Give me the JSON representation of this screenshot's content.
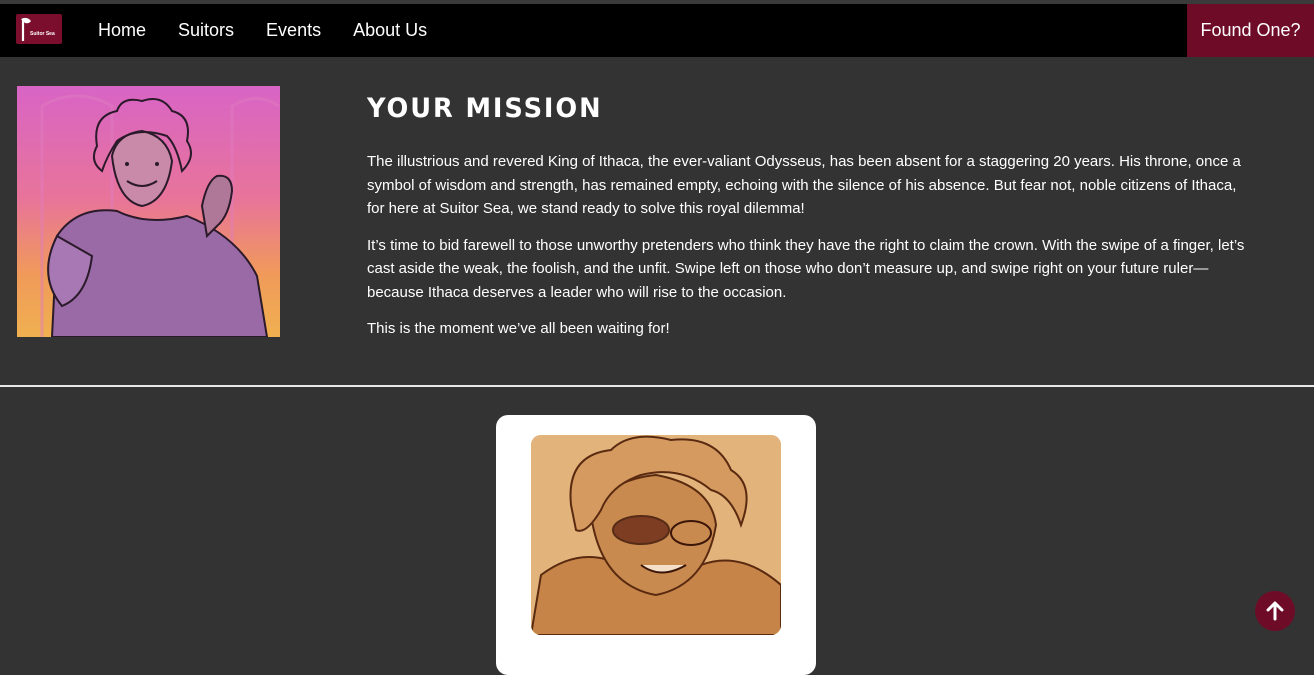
{
  "brand": {
    "logo_text": "Suitor Sea",
    "accent": "#6e0c28"
  },
  "nav": {
    "links": [
      "Home",
      "Suitors",
      "Events",
      "About Us"
    ],
    "cta": "Found One?"
  },
  "mission": {
    "title": "YOUR MISSION",
    "paragraphs": [
      "The illustrious and revered King of Ithaca, the ever-valiant Odysseus, has been absent for a staggering 20 years. His throne, once a symbol of wisdom and strength, has remained empty, echoing with the silence of his absence. But fear not, noble citizens of Ithaca, for here at Suitor Sea, we stand ready to solve this royal dilemma!",
      "It’s time to bid farewell to those unworthy pretenders who think they have the right to claim the crown. With the swipe of a finger, let’s cast aside the weak, the foolish, and the unfit. Swipe left on those who don’t measure up, and swipe right on your future ruler—because Ithaca deserves a leader who will rise to the occasion.",
      "This is the moment we’ve all been waiting for!"
    ]
  },
  "icons": {
    "scroll_top": "arrow-up-icon",
    "logo": "axe-icon"
  }
}
